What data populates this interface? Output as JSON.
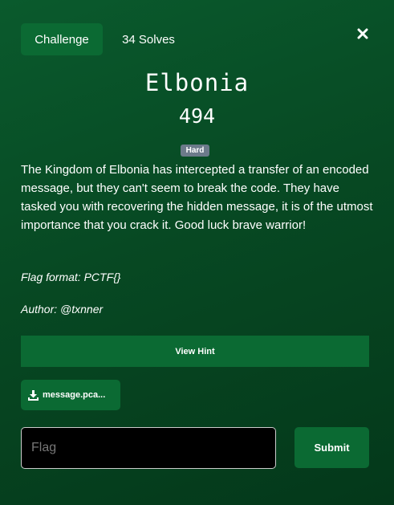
{
  "tabs": {
    "challenge_label": "Challenge",
    "solves_label": "34 Solves"
  },
  "close": {
    "icon": "close-icon"
  },
  "challenge": {
    "name": "Elbonia",
    "points": "494",
    "difficulty": "Hard",
    "description": "The Kingdom of Elbonia has intercepted a transfer of an encoded message, but they can't seem to break the code. They have tasked you with recovering the hidden message, it is of the utmost importance that you crack it. Good luck brave warrior!",
    "flag_format": "Flag format: PCTF{}",
    "author": "Author: @txnner"
  },
  "actions": {
    "hint_label": "View Hint",
    "file_label": "message.pca...",
    "file_icon": "download-icon",
    "flag_placeholder": "Flag",
    "flag_value": "",
    "submit_label": "Submit"
  },
  "colors": {
    "background": "#074923",
    "button": "#0b6a33",
    "badge": "#6c7a8a",
    "input_bg": "#000000"
  }
}
